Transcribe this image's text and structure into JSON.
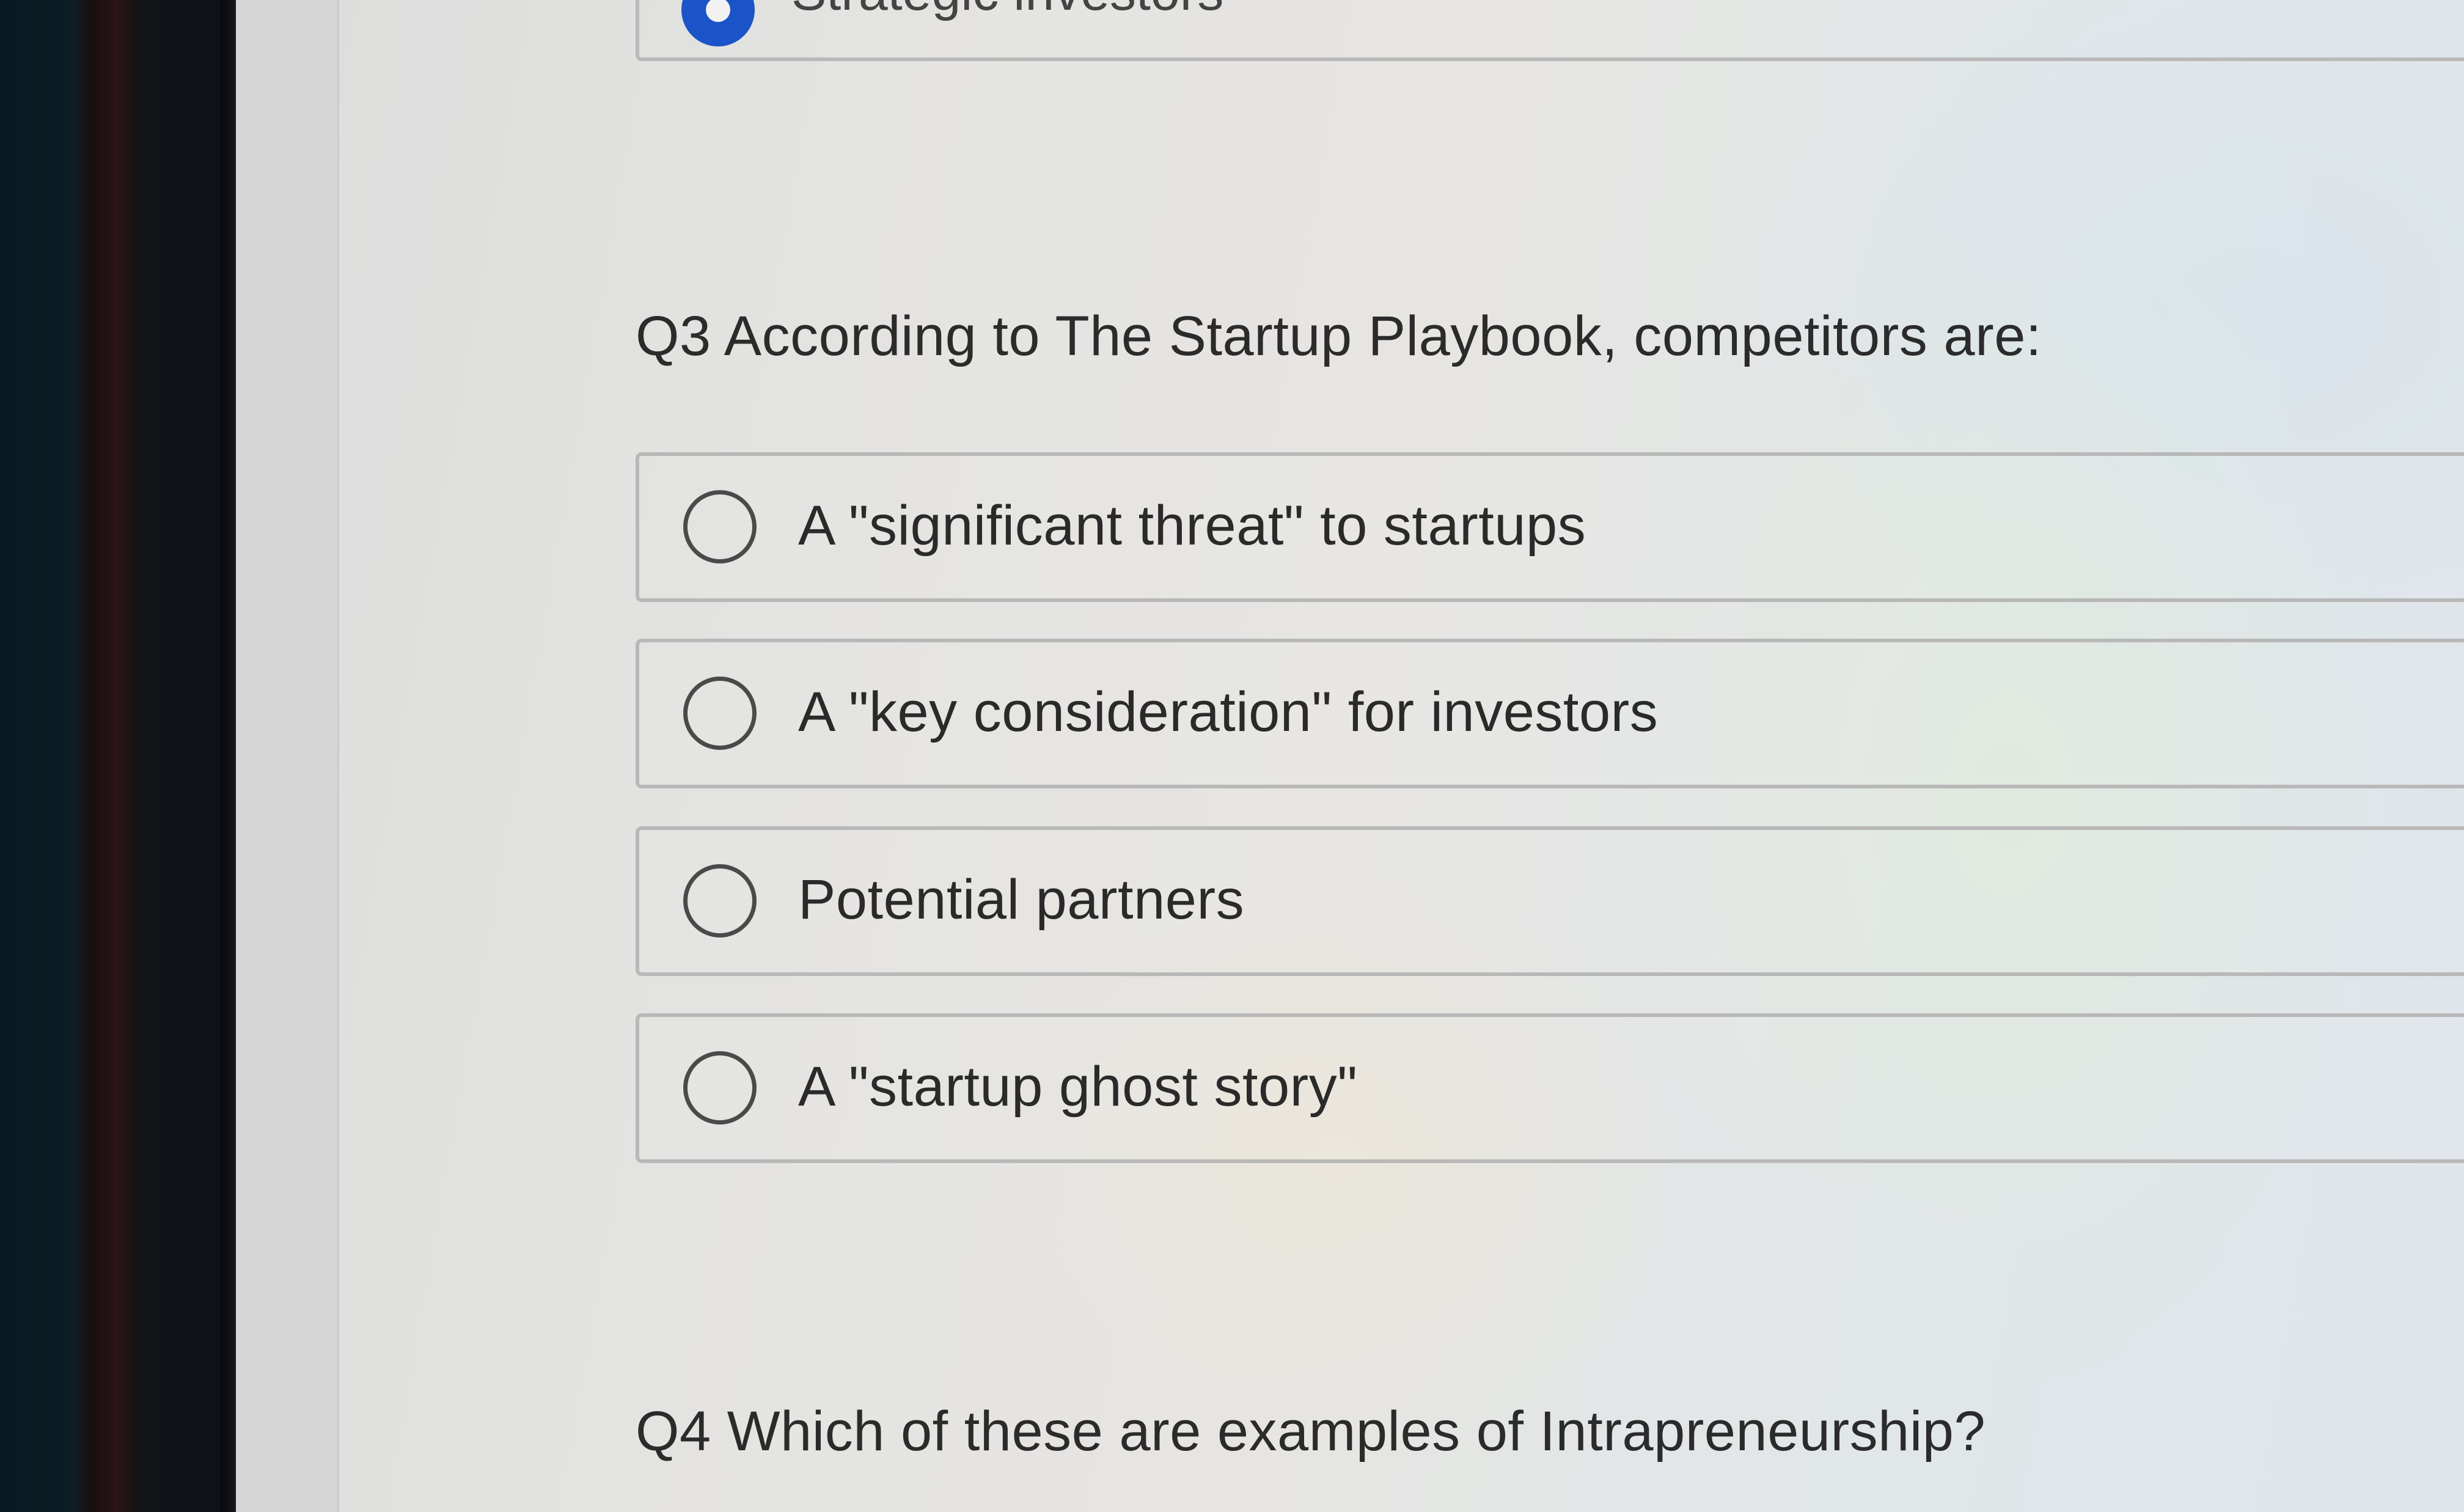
{
  "previous_question": {
    "selected_option_label": "Strategic investors"
  },
  "q3": {
    "prompt": "Q3 According to The Startup Playbook, competitors are:",
    "options": [
      {
        "label": "A \"significant threat\" to startups",
        "selected": false
      },
      {
        "label": "A \"key consideration\" for investors",
        "selected": false
      },
      {
        "label": "Potential partners",
        "selected": false
      },
      {
        "label": "A \"startup ghost story\"",
        "selected": false
      }
    ]
  },
  "q4": {
    "prompt": "Q4 Which of these are examples of Intrapreneurship?"
  },
  "colors": {
    "selected_radio": "#1b53c9",
    "option_border": "#b8b8b8",
    "text": "#2a2a2a"
  }
}
